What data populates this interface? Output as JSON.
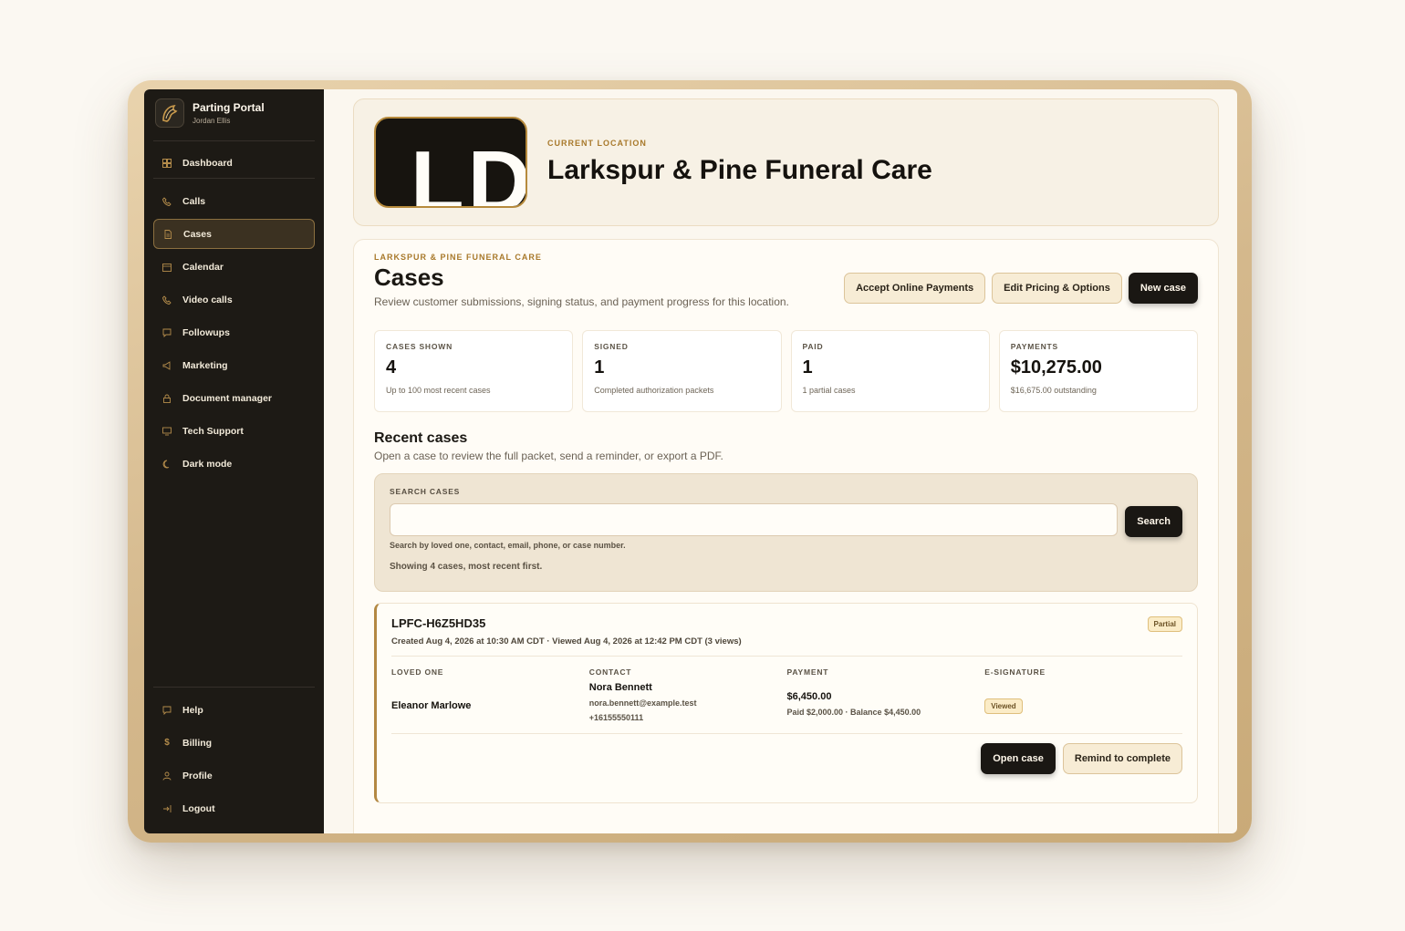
{
  "brand": {
    "name": "Parting Portal",
    "user": "Jordan Ellis"
  },
  "sidebar": {
    "items": [
      {
        "label": "Dashboard",
        "icon": "grid-icon"
      },
      {
        "label": "Calls",
        "icon": "phone-icon"
      },
      {
        "label": "Cases",
        "icon": "file-icon",
        "active": true
      },
      {
        "label": "Calendar",
        "icon": "calendar-icon"
      },
      {
        "label": "Video calls",
        "icon": "video-icon"
      },
      {
        "label": "Followups",
        "icon": "message-icon"
      },
      {
        "label": "Marketing",
        "icon": "megaphone-icon"
      },
      {
        "label": "Document manager",
        "icon": "lock-icon"
      },
      {
        "label": "Tech Support",
        "icon": "monitor-icon"
      },
      {
        "label": "Dark mode",
        "icon": "moon-icon"
      }
    ],
    "bottom": [
      {
        "label": "Help",
        "icon": "help-icon"
      },
      {
        "label": "Billing",
        "icon": "dollar-icon"
      },
      {
        "label": "Profile",
        "icon": "user-icon"
      },
      {
        "label": "Logout",
        "icon": "logout-icon"
      }
    ]
  },
  "location": {
    "eyebrow": "CURRENT LOCATION",
    "name": "Larkspur & Pine Funeral Care",
    "logo_text": "LD"
  },
  "cases_page": {
    "eyebrow": "LARKSPUR & PINE FUNERAL CARE",
    "title": "Cases",
    "subtitle": "Review customer submissions, signing status, and payment progress for this location.",
    "buttons": {
      "accept_payments": "Accept Online Payments",
      "edit_pricing": "Edit Pricing & Options",
      "new_case": "New case"
    },
    "stats": [
      {
        "label": "CASES SHOWN",
        "value": "4",
        "note": "Up to 100 most recent cases"
      },
      {
        "label": "SIGNED",
        "value": "1",
        "note": "Completed authorization packets"
      },
      {
        "label": "PAID",
        "value": "1",
        "note": "1 partial cases"
      },
      {
        "label": "PAYMENTS",
        "value": "$10,275.00",
        "note": "$16,675.00 outstanding"
      }
    ],
    "recent": {
      "title": "Recent cases",
      "subtitle": "Open a case to review the full packet, send a reminder, or export a PDF."
    },
    "search": {
      "label": "SEARCH CASES",
      "placeholder": "",
      "help": "Search by loved one, contact, email, phone, or case number.",
      "count": "Showing 4 cases, most recent first.",
      "button": "Search"
    },
    "case": {
      "id": "LPFC-H6Z5HD35",
      "meta": "Created Aug 4, 2026 at 10:30 AM CDT · Viewed Aug 4, 2026 at 12:42 PM CDT (3 views)",
      "status": "Partial",
      "loved_one_label": "LOVED ONE",
      "loved_one": "Eleanor Marlowe",
      "contact_label": "CONTACT",
      "contact_name": "Nora Bennett",
      "contact_email": "nora.bennett@example.test",
      "contact_phone": "+16155550111",
      "payment_label": "PAYMENT",
      "payment_total": "$6,450.00",
      "payment_detail": "Paid $2,000.00 · Balance $4,450.00",
      "esig_label": "E-SIGNATURE",
      "esig_status": "Viewed",
      "open_button": "Open case",
      "remind_button": "Remind to complete"
    }
  }
}
